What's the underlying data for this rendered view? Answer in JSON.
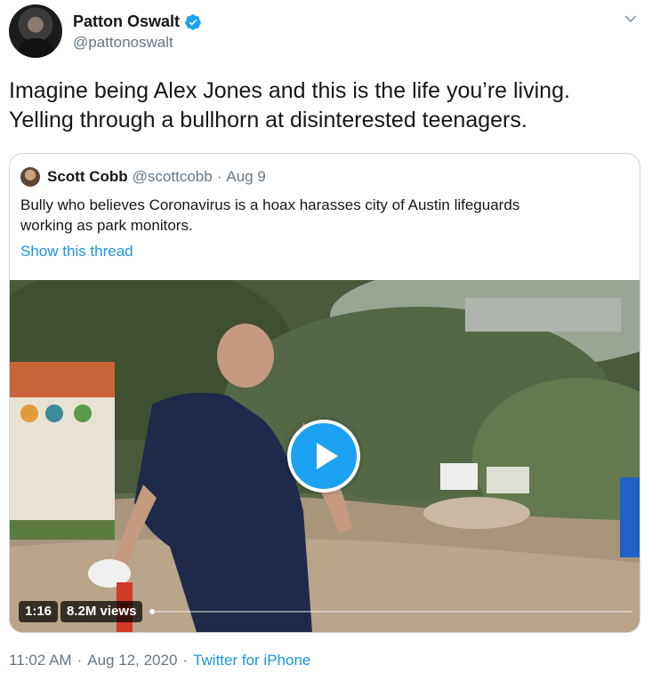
{
  "author": {
    "name": "Patton Oswalt",
    "handle": "@pattonoswalt",
    "verified": true
  },
  "tweet": {
    "text": "Imagine being Alex Jones and this is the life you’re living.\nYelling through a bullhorn at disinterested teenagers."
  },
  "quoted_tweet": {
    "name": "Scott Cobb",
    "handle": "@scottcobb",
    "date": "Aug 9",
    "text": "Bully who believes Coronavirus is a hoax harasses city of Austin lifeguards\nworking as park monitors.",
    "show_thread": "Show this thread",
    "video": {
      "duration": "1:16",
      "views": "8.2M views",
      "progress": 0.0
    }
  },
  "meta": {
    "time": "11:02 AM",
    "date": "Aug 12, 2020",
    "source": "Twitter for iPhone"
  },
  "colors": {
    "accent": "#1da1f2",
    "link": "#1b95e0",
    "secondary_text": "#657786",
    "border": "#ccd6dd"
  },
  "icons": [
    "verified-badge-icon",
    "chevron-down-icon",
    "play-icon"
  ]
}
